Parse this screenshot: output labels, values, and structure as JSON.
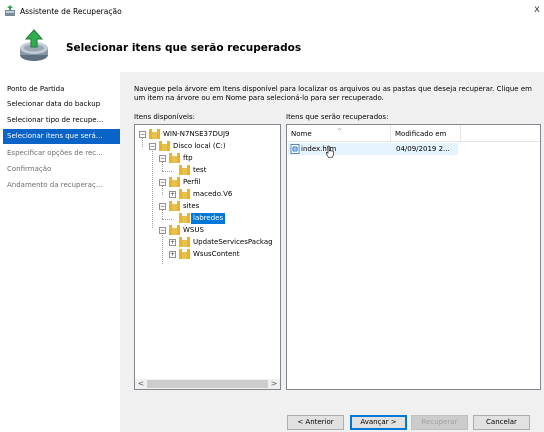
{
  "window": {
    "title": "Assistente de Recuperação",
    "close_glyph": "x"
  },
  "header": {
    "title": "Selecionar itens que serão recuperados"
  },
  "nav": {
    "items": [
      {
        "label": "Ponto de Partida",
        "state": "normal"
      },
      {
        "label": "Selecionar data do backup",
        "state": "normal"
      },
      {
        "label": "Selecionar tipo de recupe...",
        "state": "normal"
      },
      {
        "label": "Selecionar itens que será...",
        "state": "selected"
      },
      {
        "label": "Especificar opções de rec...",
        "state": "disabled"
      },
      {
        "label": "Confirmação",
        "state": "disabled"
      },
      {
        "label": "Andamento da recuperaç...",
        "state": "disabled"
      }
    ]
  },
  "main": {
    "instructions": "Navegue pela árvore em Itens disponível para localizar os arquivos ou as pastas que deseja recuperar. Clique em um item na árvore ou em Nome para selecioná-lo para ser recuperado.",
    "available_label": "Itens disponíveis:",
    "recover_label": "Itens que serão recuperados:"
  },
  "tree": {
    "nodes": [
      {
        "label": "WIN-N7NSE37DUJ9",
        "expander": "−",
        "selected": false
      },
      {
        "label": "Disco local (C:)",
        "expander": "−",
        "selected": false
      },
      {
        "label": "ftp",
        "expander": "−",
        "selected": false
      },
      {
        "label": "test",
        "expander": "",
        "selected": false
      },
      {
        "label": "Perfil",
        "expander": "−",
        "selected": false
      },
      {
        "label": "macedo.V6",
        "expander": "+",
        "selected": false
      },
      {
        "label": "sites",
        "expander": "−",
        "selected": false
      },
      {
        "label": "labredes",
        "expander": "",
        "selected": true
      },
      {
        "label": "WSUS",
        "expander": "−",
        "selected": false
      },
      {
        "label": "UpdateServicesPackag",
        "expander": "+",
        "selected": false
      },
      {
        "label": "WsusContent",
        "expander": "+",
        "selected": false
      }
    ],
    "scroll_left": "<",
    "scroll_right": ">"
  },
  "list": {
    "columns": {
      "name": "Nome",
      "modified": "Modificado em"
    },
    "rows": [
      {
        "name": "index.htm",
        "modified": "04/09/2019 2..."
      }
    ]
  },
  "buttons": {
    "back": "< Anterior",
    "next": "Avançar >",
    "recover": "Recuperar",
    "cancel": "Cancelar"
  },
  "colors": {
    "nav_selected": "#0a64c8",
    "tree_selected": "#0078d7",
    "folder": "#e6b428"
  }
}
